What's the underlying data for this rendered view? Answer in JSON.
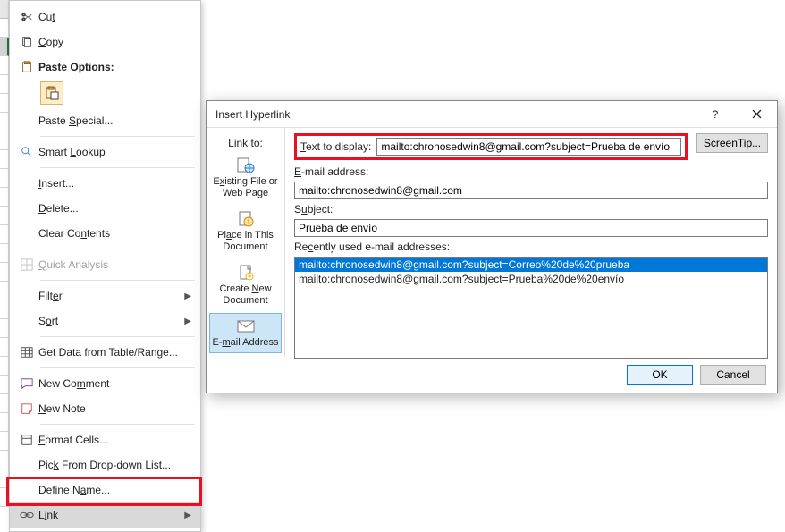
{
  "context_menu": {
    "cut": "Cut",
    "copy": "Copy",
    "paste_options": "Paste Options:",
    "paste_special": "Paste Special...",
    "smart_lookup": "Smart Lookup",
    "insert": "Insert...",
    "delete": "Delete...",
    "clear_contents": "Clear Contents",
    "quick_analysis": "Quick Analysis",
    "filter": "Filter",
    "sort": "Sort",
    "get_data": "Get Data from Table/Range...",
    "new_comment": "New Comment",
    "new_note": "New Note",
    "format_cells": "Format Cells...",
    "pick_from_list": "Pick From Drop-down List...",
    "define_name": "Define Name...",
    "link": "Link"
  },
  "dialog": {
    "title": "Insert Hyperlink",
    "link_to_label": "Link to:",
    "tabs": {
      "existing": "Existing File or Web Page",
      "place": "Place in This Document",
      "create_new": "Create New Document",
      "email": "E-mail Address"
    },
    "text_to_display_label": "Text to display:",
    "text_to_display_value": "mailto:chronosedwin8@gmail.com?subject=Prueba de envío",
    "screentip_label": "ScreenTip...",
    "email_address_label": "E-mail address:",
    "email_address_value": "mailto:chronosedwin8@gmail.com",
    "subject_label": "Subject:",
    "subject_value": "Prueba de envío",
    "recent_label": "Recently used e-mail addresses:",
    "recent_items": [
      "mailto:chronosedwin8@gmail.com?subject=Correo%20de%20prueba",
      "mailto:chronosedwin8@gmail.com?subject=Prueba%20de%20envío"
    ],
    "ok": "OK",
    "cancel": "Cancel"
  },
  "colors": {
    "accent_red": "#e81123",
    "selection_blue": "#0078d7",
    "tab_selected": "#cde6f7"
  }
}
